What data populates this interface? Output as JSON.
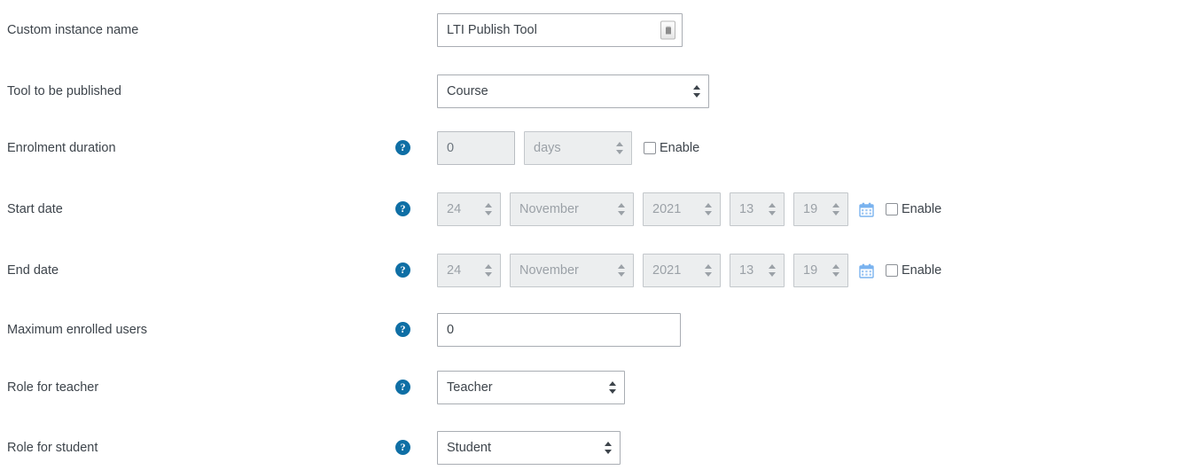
{
  "colors": {
    "help_icon": "#0f6fa5",
    "calendar_icon": "#7ab3ef",
    "text": "#3d444b",
    "disabled_text": "#9ba1a7",
    "disabled_bg": "#eceeef",
    "border": "#a9adb3"
  },
  "rows": [
    {
      "label": "Custom instance name",
      "help": false,
      "value": "LTI Publish Tool",
      "icon": "autofill-icon"
    },
    {
      "label": "Tool to be published",
      "help": false,
      "value": "Course"
    },
    {
      "label": "Enrolment duration",
      "help": true,
      "help_glyph": "?",
      "number_value": "0",
      "unit_value": "days",
      "enable_label": "Enable",
      "enabled": false
    },
    {
      "label": "Start date",
      "help": true,
      "help_glyph": "?",
      "day": "24",
      "month": "November",
      "year": "2021",
      "hour": "13",
      "minute": "19",
      "enable_label": "Enable",
      "enabled": false
    },
    {
      "label": "End date",
      "help": true,
      "help_glyph": "?",
      "day": "24",
      "month": "November",
      "year": "2021",
      "hour": "13",
      "minute": "19",
      "enable_label": "Enable",
      "enabled": false
    },
    {
      "label": "Maximum enrolled users",
      "help": true,
      "help_glyph": "?",
      "value": "0"
    },
    {
      "label": "Role for teacher",
      "help": true,
      "help_glyph": "?",
      "value": "Teacher"
    },
    {
      "label": "Role for student",
      "help": true,
      "help_glyph": "?",
      "value": "Student"
    }
  ]
}
